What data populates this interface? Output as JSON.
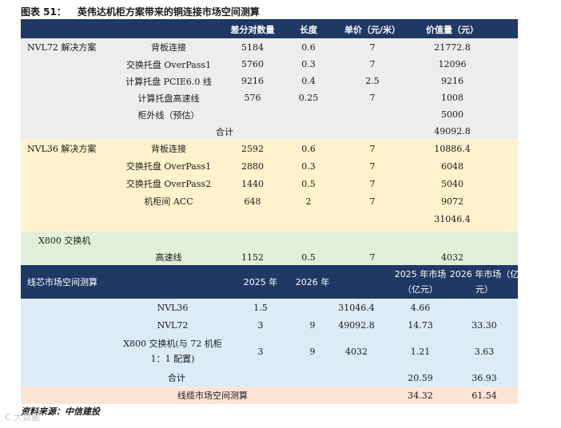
{
  "figure": {
    "label": "图表 51：",
    "title": "英伟达机柜方案带来的铜连接市场空间测算"
  },
  "header": {
    "qty": "差分对数量",
    "length": "长度",
    "price": "单价（元/米）",
    "value": "价值量（元）"
  },
  "nvl72": {
    "name": "NVL72 解决方案",
    "rows": [
      {
        "item": "背板连接",
        "qty": "5184",
        "length": "0.6",
        "price": "7",
        "value": "21772.8"
      },
      {
        "item": "交换托盘 OverPass1",
        "qty": "5760",
        "length": "0.3",
        "price": "7",
        "value": "12096"
      },
      {
        "item": "计算托盘 PCIE6.0 线",
        "qty": "9216",
        "length": "0.4",
        "price": "2.5",
        "value": "9216"
      },
      {
        "item": "计算托盘高速线",
        "qty": "576",
        "length": "0.25",
        "price": "7",
        "value": "1008"
      },
      {
        "item": "柜外线（预估）",
        "qty": "",
        "length": "",
        "price": "",
        "value": "5000"
      }
    ],
    "total_label": "合计",
    "total": "49092.8"
  },
  "nvl36": {
    "name": "NVL36 解决方案",
    "rows": [
      {
        "item": "背板连接",
        "qty": "2592",
        "length": "0.6",
        "price": "7",
        "value": "10886.4"
      },
      {
        "item": "交换托盘 OverPass1",
        "qty": "2880",
        "length": "0.3",
        "price": "7",
        "value": "6048"
      },
      {
        "item": "交换托盘 OverPass2",
        "qty": "1440",
        "length": "0.5",
        "price": "7",
        "value": "5040"
      },
      {
        "item": "机柜间 ACC",
        "qty": "648",
        "length": "2",
        "price": "7",
        "value": "9072"
      }
    ],
    "total": "31046.4"
  },
  "x800": {
    "name": "X800 交换机",
    "row": {
      "item": "高速线",
      "qty": "1152",
      "length": "0.5",
      "price": "7",
      "value": "4032"
    }
  },
  "market_header": {
    "title": "线芯市场空间测算",
    "y2025": "2025 年",
    "y2026": "2026 年",
    "m2025_line1": "2025 年市场",
    "m2025_line2": "（亿元）",
    "m2026_line1": "2026 年市场（亿",
    "m2026_line2": "元）"
  },
  "market_rows": [
    {
      "name": "NVL36",
      "y2025": "1.5",
      "y2026": "",
      "unit": "31046.4",
      "m2025": "4.66",
      "m2026": ""
    },
    {
      "name": "NVL72",
      "y2025": "3",
      "y2026": "9",
      "unit": "49092.8",
      "m2025": "14.73",
      "m2026": "33.30"
    }
  ],
  "market_x800": {
    "name_line1": "X800 交换机(与 72 机柜",
    "name_line2": "1：1 配置)",
    "y2025": "3",
    "y2026": "9",
    "unit": "4032",
    "m2025": "1.21",
    "m2026": "3.63"
  },
  "market_total": {
    "label": "合计",
    "m2025": "20.59",
    "m2026": "36.93"
  },
  "cable_total": {
    "label": "线缆市场空间测算",
    "m2025": "34.32",
    "m2026": "61.54"
  },
  "source": "资料来源：中信建投",
  "watermark": "C 大数据"
}
